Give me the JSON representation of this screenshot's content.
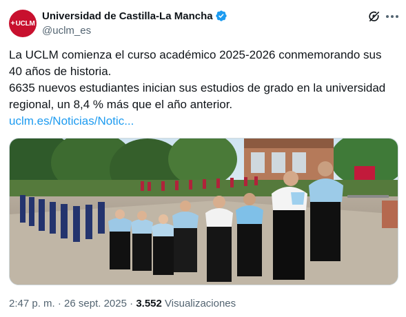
{
  "account": {
    "avatar_text": "UCLM",
    "display_name": "Universidad de Castilla-La Mancha",
    "handle": "@uclm_es",
    "verified_badge_icon": "verified-badge-icon",
    "brand_color": "#c8102e"
  },
  "header_actions": {
    "grok_icon": "grok-icon",
    "more_icon": "more-options-icon"
  },
  "tweet": {
    "line1": "La UCLM comienza el curso académico 2025-2026 conmemorando sus",
    "line2": "40 años de historia.",
    "line3": "6635 nuevos estudiantes inician sus estudios de grado en la universidad",
    "line4": "regional, un 8,4 % más que el año anterior.",
    "link_text": "uclm.es/Noticias/Notic..."
  },
  "media": {
    "description_icon": "photo-academic-procession"
  },
  "footer": {
    "time": "2:47 p. m.",
    "separator": " · ",
    "date": "26 sept. 2025",
    "views_count": "3.552",
    "views_label": "Visualizaciones"
  },
  "colors": {
    "link": "#1d9bf0",
    "secondary_text": "#536471",
    "verified": "#1d9bf0"
  }
}
